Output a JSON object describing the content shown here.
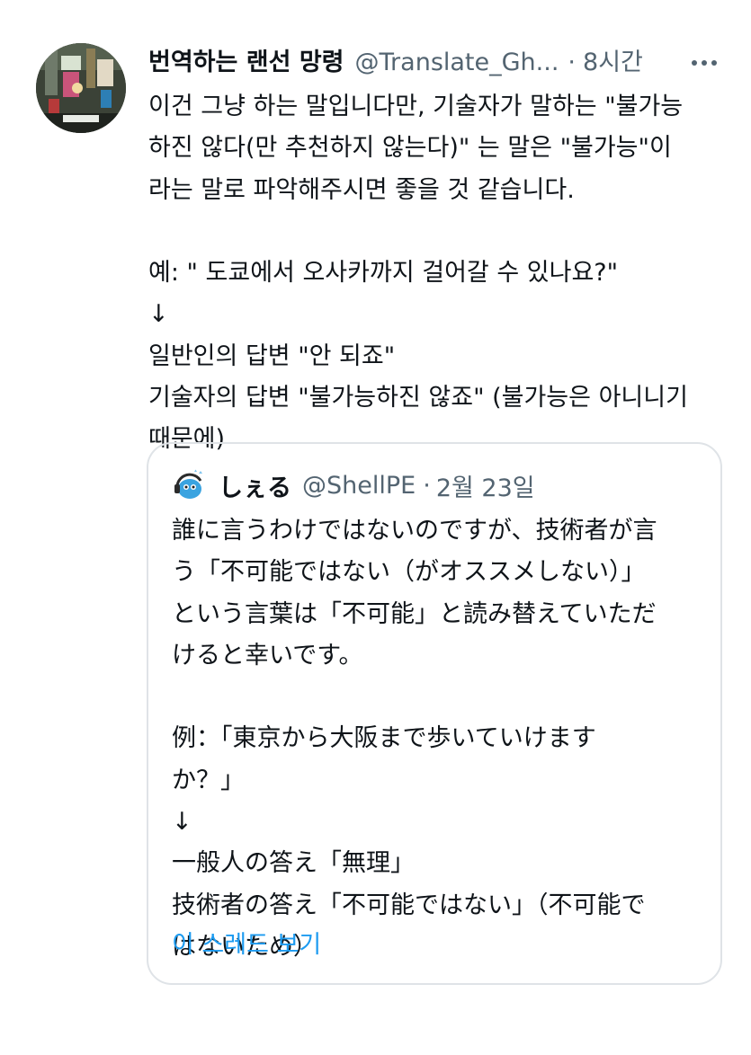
{
  "tweet": {
    "author_name": "번역하는 랜선 망령",
    "author_handle": "@Translate_Gh...",
    "separator": "·",
    "timestamp": "8시간",
    "lines": [
      "이건 그냥 하는 말입니다만, 기술자가 말하는 \"불가능",
      "하진 않다(만 추천하지 않는다)\" 는 말은 \"불가능\"이",
      "라는 말로 파악해주시면 좋을 것 같습니다.",
      "",
      "예: \" 도쿄에서 오사카까지 걸어갈 수 있나요?\"",
      "↓",
      "일반인의 답변 \"안 되죠\"",
      "기술자의 답변 \"불가능하진 않죠\" (불가능은 아니니기",
      "때문에)"
    ]
  },
  "quote": {
    "author_name": "しぇる",
    "author_handle": "@ShellPE",
    "separator": "·",
    "date": "2월 23일",
    "lines": [
      "誰に言うわけではないのですが、技術者が言",
      "う「不可能ではない（がオススメしない）」",
      "という言葉は「不可能」と読み替えていただ",
      "けると幸いです。",
      "",
      "例：「東京から大阪まで歩いていけます",
      "か？」",
      "↓",
      "一般人の答え「無理」",
      "技術者の答え「不可能ではない」（不可能で",
      "はないため）"
    ],
    "thread_link": "이 스레드 보기"
  },
  "icons": {
    "more": "more-horizontal-icon",
    "avatar": "user-avatar",
    "quote_avatar": "blue-creature-with-headphones-avatar"
  },
  "colors": {
    "text": "#0f1419",
    "secondary": "#536471",
    "link": "#1d9bf0",
    "border": "#dfe3e7"
  }
}
